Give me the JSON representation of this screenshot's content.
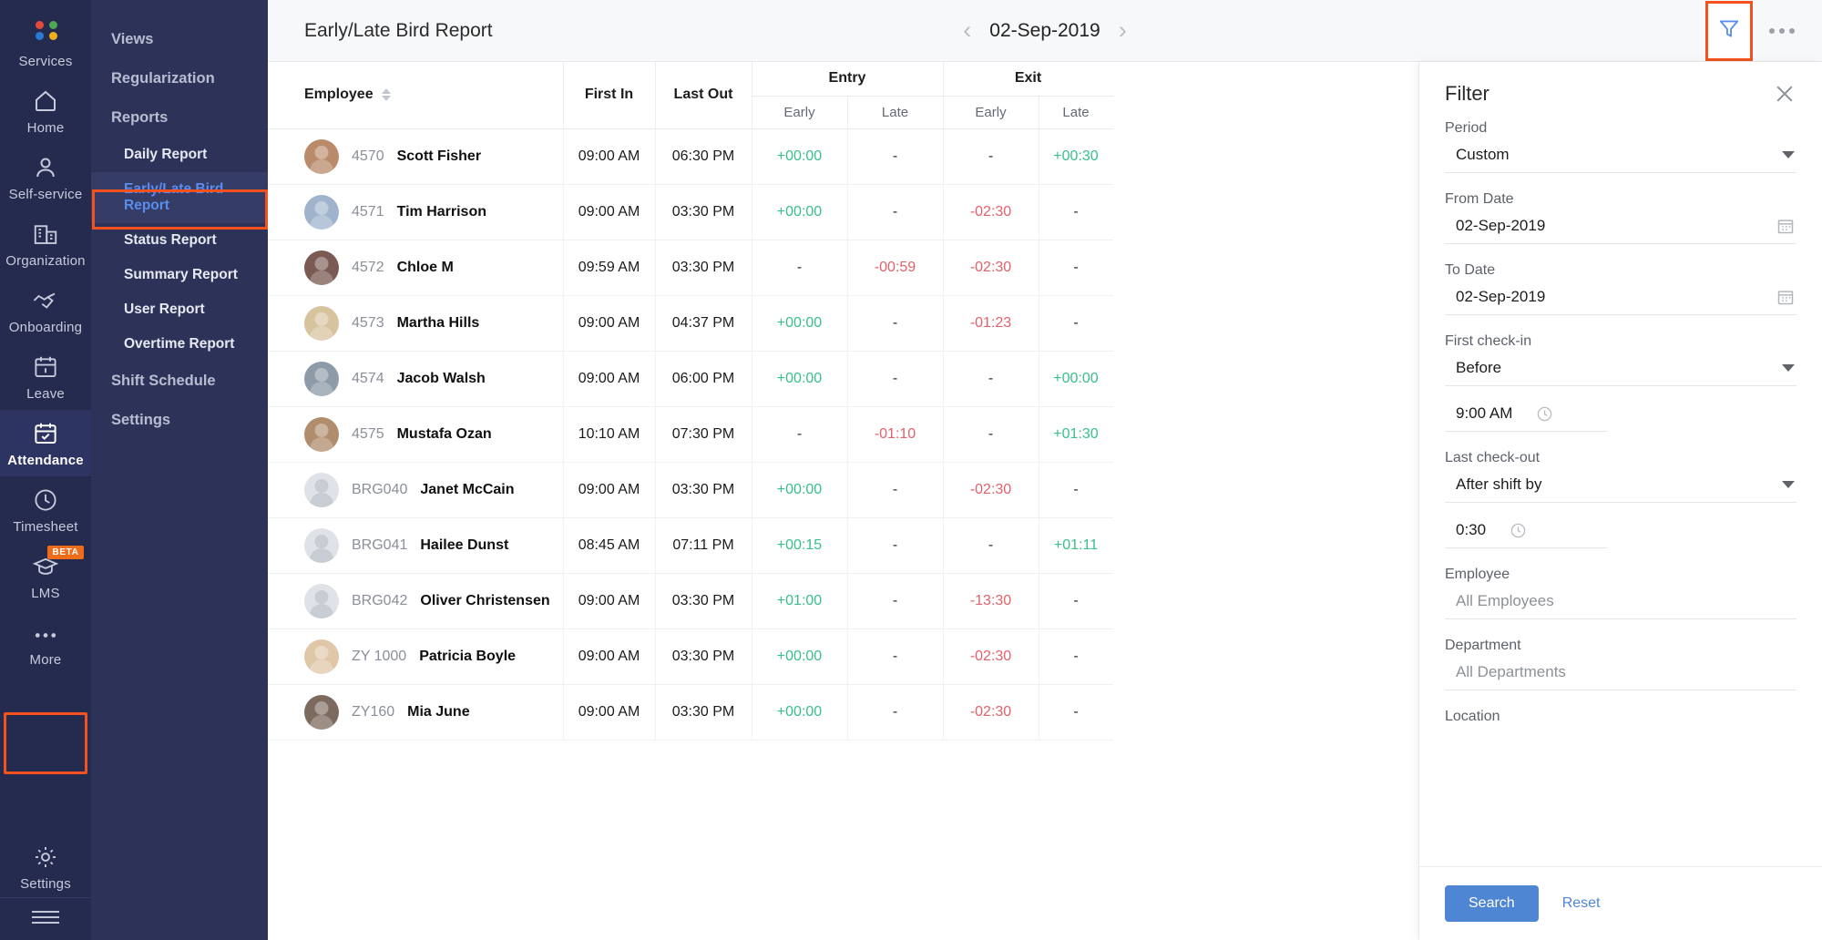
{
  "rail": {
    "brand": {
      "label": "Services",
      "icon": "four-dots-logo"
    },
    "items": [
      {
        "label": "Home",
        "icon": "home-icon",
        "active": false
      },
      {
        "label": "Self-service",
        "icon": "user-icon",
        "active": false
      },
      {
        "label": "Organization",
        "icon": "building-icon",
        "active": false
      },
      {
        "label": "Onboarding",
        "icon": "handshake-icon",
        "active": false
      },
      {
        "label": "Leave",
        "icon": "calendar-icon",
        "active": false
      },
      {
        "label": "Attendance",
        "icon": "calendar-check-icon",
        "active": true
      },
      {
        "label": "Timesheet",
        "icon": "clock-icon",
        "active": false
      },
      {
        "label": "LMS",
        "icon": "graduation-cap-icon",
        "active": false,
        "badge": "BETA"
      },
      {
        "label": "More",
        "icon": "ellipsis-icon",
        "active": false
      }
    ],
    "settings": {
      "label": "Settings",
      "icon": "gear-icon"
    },
    "menu_toggle": "hamburger-icon"
  },
  "subnav": {
    "sections": [
      {
        "label": "Views",
        "type": "section"
      },
      {
        "label": "Regularization",
        "type": "section"
      },
      {
        "label": "Reports",
        "type": "section"
      },
      {
        "label": "Daily Report",
        "type": "item",
        "active": false
      },
      {
        "label": "Early/Late Bird Report",
        "type": "item",
        "active": true
      },
      {
        "label": "Status Report",
        "type": "item",
        "active": false
      },
      {
        "label": "Summary Report",
        "type": "item",
        "active": false
      },
      {
        "label": "User Report",
        "type": "item",
        "active": false
      },
      {
        "label": "Overtime Report",
        "type": "item",
        "active": false
      },
      {
        "label": "Shift Schedule",
        "type": "section"
      },
      {
        "label": "Settings",
        "type": "section"
      }
    ]
  },
  "topbar": {
    "title": "Early/Late Bird Report",
    "prev_icon": "chevron-left-icon",
    "date": "02-Sep-2019",
    "next_icon": "chevron-right-icon",
    "filter_icon": "funnel-icon",
    "more_icon": "ellipsis-icon"
  },
  "table": {
    "headers": {
      "employee": "Employee",
      "first_in": "First In",
      "last_out": "Last Out",
      "entry": "Entry",
      "exit": "Exit",
      "entry_early": "Early",
      "entry_late": "Late",
      "exit_early": "Early",
      "exit_late": "Late"
    },
    "rows": [
      {
        "id": "4570",
        "name": "Scott Fisher",
        "avatar": "photo",
        "first_in": "09:00 AM",
        "last_out": "06:30 PM",
        "entry_early": "+00:00",
        "entry_late": "-",
        "exit_early": "-",
        "exit_late": "+00:30"
      },
      {
        "id": "4571",
        "name": "Tim Harrison",
        "avatar": "photo",
        "first_in": "09:00 AM",
        "last_out": "03:30 PM",
        "entry_early": "+00:00",
        "entry_late": "-",
        "exit_early": "-02:30",
        "exit_late": "-"
      },
      {
        "id": "4572",
        "name": "Chloe M",
        "avatar": "photo",
        "first_in": "09:59 AM",
        "last_out": "03:30 PM",
        "entry_early": "-",
        "entry_late": "-00:59",
        "exit_early": "-02:30",
        "exit_late": "-"
      },
      {
        "id": "4573",
        "name": "Martha Hills",
        "avatar": "photo",
        "first_in": "09:00 AM",
        "last_out": "04:37 PM",
        "entry_early": "+00:00",
        "entry_late": "-",
        "exit_early": "-01:23",
        "exit_late": "-"
      },
      {
        "id": "4574",
        "name": "Jacob Walsh",
        "avatar": "photo",
        "first_in": "09:00 AM",
        "last_out": "06:00 PM",
        "entry_early": "+00:00",
        "entry_late": "-",
        "exit_early": "-",
        "exit_late": "+00:00"
      },
      {
        "id": "4575",
        "name": "Mustafa Ozan",
        "avatar": "photo",
        "first_in": "10:10 AM",
        "last_out": "07:30 PM",
        "entry_early": "-",
        "entry_late": "-01:10",
        "exit_early": "-",
        "exit_late": "+01:30"
      },
      {
        "id": "BRG040",
        "name": "Janet McCain",
        "avatar": "placeholder",
        "first_in": "09:00 AM",
        "last_out": "03:30 PM",
        "entry_early": "+00:00",
        "entry_late": "-",
        "exit_early": "-02:30",
        "exit_late": "-"
      },
      {
        "id": "BRG041",
        "name": "Hailee Dunst",
        "avatar": "placeholder",
        "first_in": "08:45 AM",
        "last_out": "07:11 PM",
        "entry_early": "+00:15",
        "entry_late": "-",
        "exit_early": "-",
        "exit_late": "+01:11"
      },
      {
        "id": "BRG042",
        "name": "Oliver Christensen",
        "avatar": "placeholder",
        "first_in": "09:00 AM",
        "last_out": "03:30 PM",
        "entry_early": "+01:00",
        "entry_late": "-",
        "exit_early": "-13:30",
        "exit_late": "-"
      },
      {
        "id": "ZY 1000",
        "name": "Patricia Boyle",
        "avatar": "photo",
        "first_in": "09:00 AM",
        "last_out": "03:30 PM",
        "entry_early": "+00:00",
        "entry_late": "-",
        "exit_early": "-02:30",
        "exit_late": "-"
      },
      {
        "id": "ZY160",
        "name": "Mia June",
        "avatar": "photo",
        "first_in": "09:00 AM",
        "last_out": "03:30 PM",
        "entry_early": "+00:00",
        "entry_late": "-",
        "exit_early": "-02:30",
        "exit_late": "-"
      }
    ]
  },
  "filter": {
    "title": "Filter",
    "close_icon": "close-icon",
    "period_label": "Period",
    "period_value": "Custom",
    "from_label": "From Date",
    "from_value": "02-Sep-2019",
    "to_label": "To Date",
    "to_value": "02-Sep-2019",
    "checkin_label": "First check-in",
    "checkin_value": "Before",
    "checkin_time": "9:00 AM",
    "checkout_label": "Last check-out",
    "checkout_value": "After shift by",
    "checkout_time": "0:30",
    "employee_label": "Employee",
    "employee_value": "All Employees",
    "department_label": "Department",
    "department_value": "All Departments",
    "location_label": "Location",
    "search_label": "Search",
    "reset_label": "Reset"
  },
  "colors": {
    "rail_bg": "#252a4f",
    "subnav_bg": "#2d3358",
    "accent_blue": "#4e86d4",
    "highlight_red": "#f4511e",
    "positive_green": "#38c08a",
    "negative_red": "#e2616a",
    "active_link": "#5b8def"
  }
}
